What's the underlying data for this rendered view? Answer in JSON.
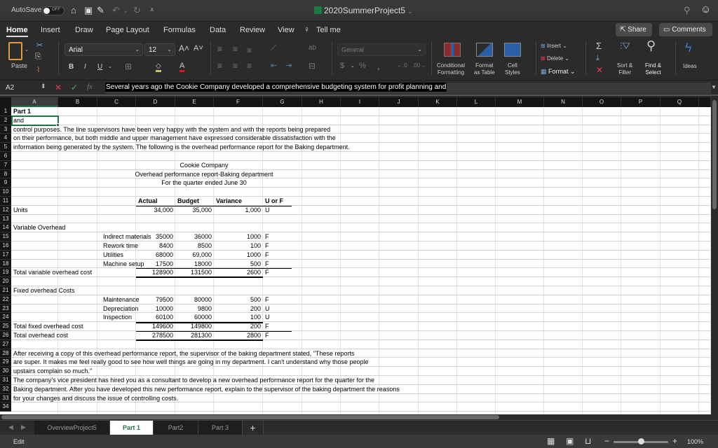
{
  "titlebar": {
    "autosave_label": "AutoSave",
    "autosave_state": "OFF",
    "document_title": "2020SummerProject5"
  },
  "menu": {
    "tabs": [
      "Home",
      "Insert",
      "Draw",
      "Page Layout",
      "Formulas",
      "Data",
      "Review",
      "View"
    ],
    "active_tab": "Home",
    "tell_me": "Tell me",
    "share": "Share",
    "comments": "Comments"
  },
  "ribbon": {
    "paste": "Paste",
    "font_name": "Arial",
    "font_size": "12",
    "number_format": "General",
    "bold": "B",
    "italic": "I",
    "underline": "U",
    "conditional_formatting": [
      "Conditional",
      "Formatting"
    ],
    "format_as_table": [
      "Format",
      "as Table"
    ],
    "cell_styles": [
      "Cell",
      "Styles"
    ],
    "insert": "Insert",
    "delete": "Delete",
    "format": "Format",
    "sort_filter": [
      "Sort &",
      "Filter"
    ],
    "find_select": [
      "Find &",
      "Select"
    ],
    "ideas": "Ideas"
  },
  "formula_bar": {
    "name_box": "A2",
    "content": "Several years ago the Cookie Company developed a comprehensive budgeting system for profit planning and"
  },
  "columns": [
    "A",
    "B",
    "C",
    "D",
    "E",
    "F",
    "G",
    "H",
    "I",
    "J",
    "K",
    "L",
    "M",
    "N",
    "O",
    "P",
    "Q"
  ],
  "selected_column": "A",
  "rows": [
    "1",
    "2",
    "3",
    "4",
    "5",
    "6",
    "7",
    "8",
    "9",
    "10",
    "11",
    "12",
    "13",
    "14",
    "15",
    "16",
    "17",
    "18",
    "19",
    "20",
    "21",
    "22",
    "23",
    "24",
    "25",
    "26",
    "27",
    "28",
    "29",
    "30",
    "31",
    "32",
    "33",
    "34"
  ],
  "sheet": {
    "r1": "Part 1",
    "r2": "and",
    "r3": "control purposes.  The line supervisors have been very happy with the system and with the reports being prepared",
    "r4": "on their performance, but both middle and upper management have expressed considerable dissatisfaction with the",
    "r5": "information being generated by the system.   The following is the overhead performance report for the Baking department.",
    "r7": "Cookie Company",
    "r8": "Overhead performance report-Baking department",
    "r9": "For the quarter ended June 30",
    "headers": [
      "Actual",
      "Budget",
      "Variance",
      "U or F"
    ],
    "units": {
      "label": "Units",
      "actual": "34,000",
      "budget": "35,000",
      "variance": "1,000",
      "uf": "U"
    },
    "variable_title": "Variable Overhead",
    "variable_items": [
      {
        "label": "Indirect materials",
        "actual": "35000",
        "budget": "36000",
        "variance": "1000",
        "uf": "F"
      },
      {
        "label": "Rework time",
        "actual": "8400",
        "budget": "8500",
        "variance": "100",
        "uf": "F"
      },
      {
        "label": "Utilities",
        "actual": "68000",
        "budget": "69,000",
        "variance": "1000",
        "uf": "F"
      },
      {
        "label": "Machine setup",
        "actual": "17500",
        "budget": "18000",
        "variance": "500",
        "uf": "F"
      }
    ],
    "variable_total": {
      "label": "Total variable overhead cost",
      "actual": "128900",
      "budget": "131500",
      "variance": "2600",
      "uf": "F"
    },
    "fixed_title": "Fixed overhead Costs",
    "fixed_items": [
      {
        "label": "Maintenance",
        "actual": "79500",
        "budget": "80000",
        "variance": "500",
        "uf": "F"
      },
      {
        "label": "Depreciation",
        "actual": "10000",
        "budget": "9800",
        "variance": "200",
        "uf": "U"
      },
      {
        "label": "Inspection",
        "actual": "60100",
        "budget": "60000",
        "variance": "100",
        "uf": "U"
      }
    ],
    "fixed_total": {
      "label": "Total fixed overhead cost",
      "actual": "149600",
      "budget": "149800",
      "variance": "200",
      "uf": "F"
    },
    "grand_total": {
      "label": "Total overhead cost",
      "actual": "278500",
      "budget": "281300",
      "variance": "2800",
      "uf": "F"
    },
    "r28": "After receiving a copy of this overhead performance report, the supervisor of the baking department stated, \"These reports",
    "r29": "are super.  It makes me feel really good to see how well things are going in my department.  I can't understand why those people",
    "r30": "upstairs complain so much.\"",
    "r31": "The company's vice president has hired you as a consultant to develop a new overhead performance report for the quarter for the",
    "r32": "Baking department.  After you have developed this new performance report, explain to the supervisor of the baking department the reasons",
    "r33": "for your changes and discuss the issue of controlling costs."
  },
  "sheet_tabs": [
    "OverviewProject5",
    "Part 1",
    "Part2",
    "Part 3"
  ],
  "active_sheet": "Part 1",
  "status": {
    "mode": "Edit",
    "zoom": "100%"
  },
  "colors": {
    "excel_green": "#217346",
    "font_color_red": "#e0102b",
    "fill_color": "#c8c06a"
  }
}
